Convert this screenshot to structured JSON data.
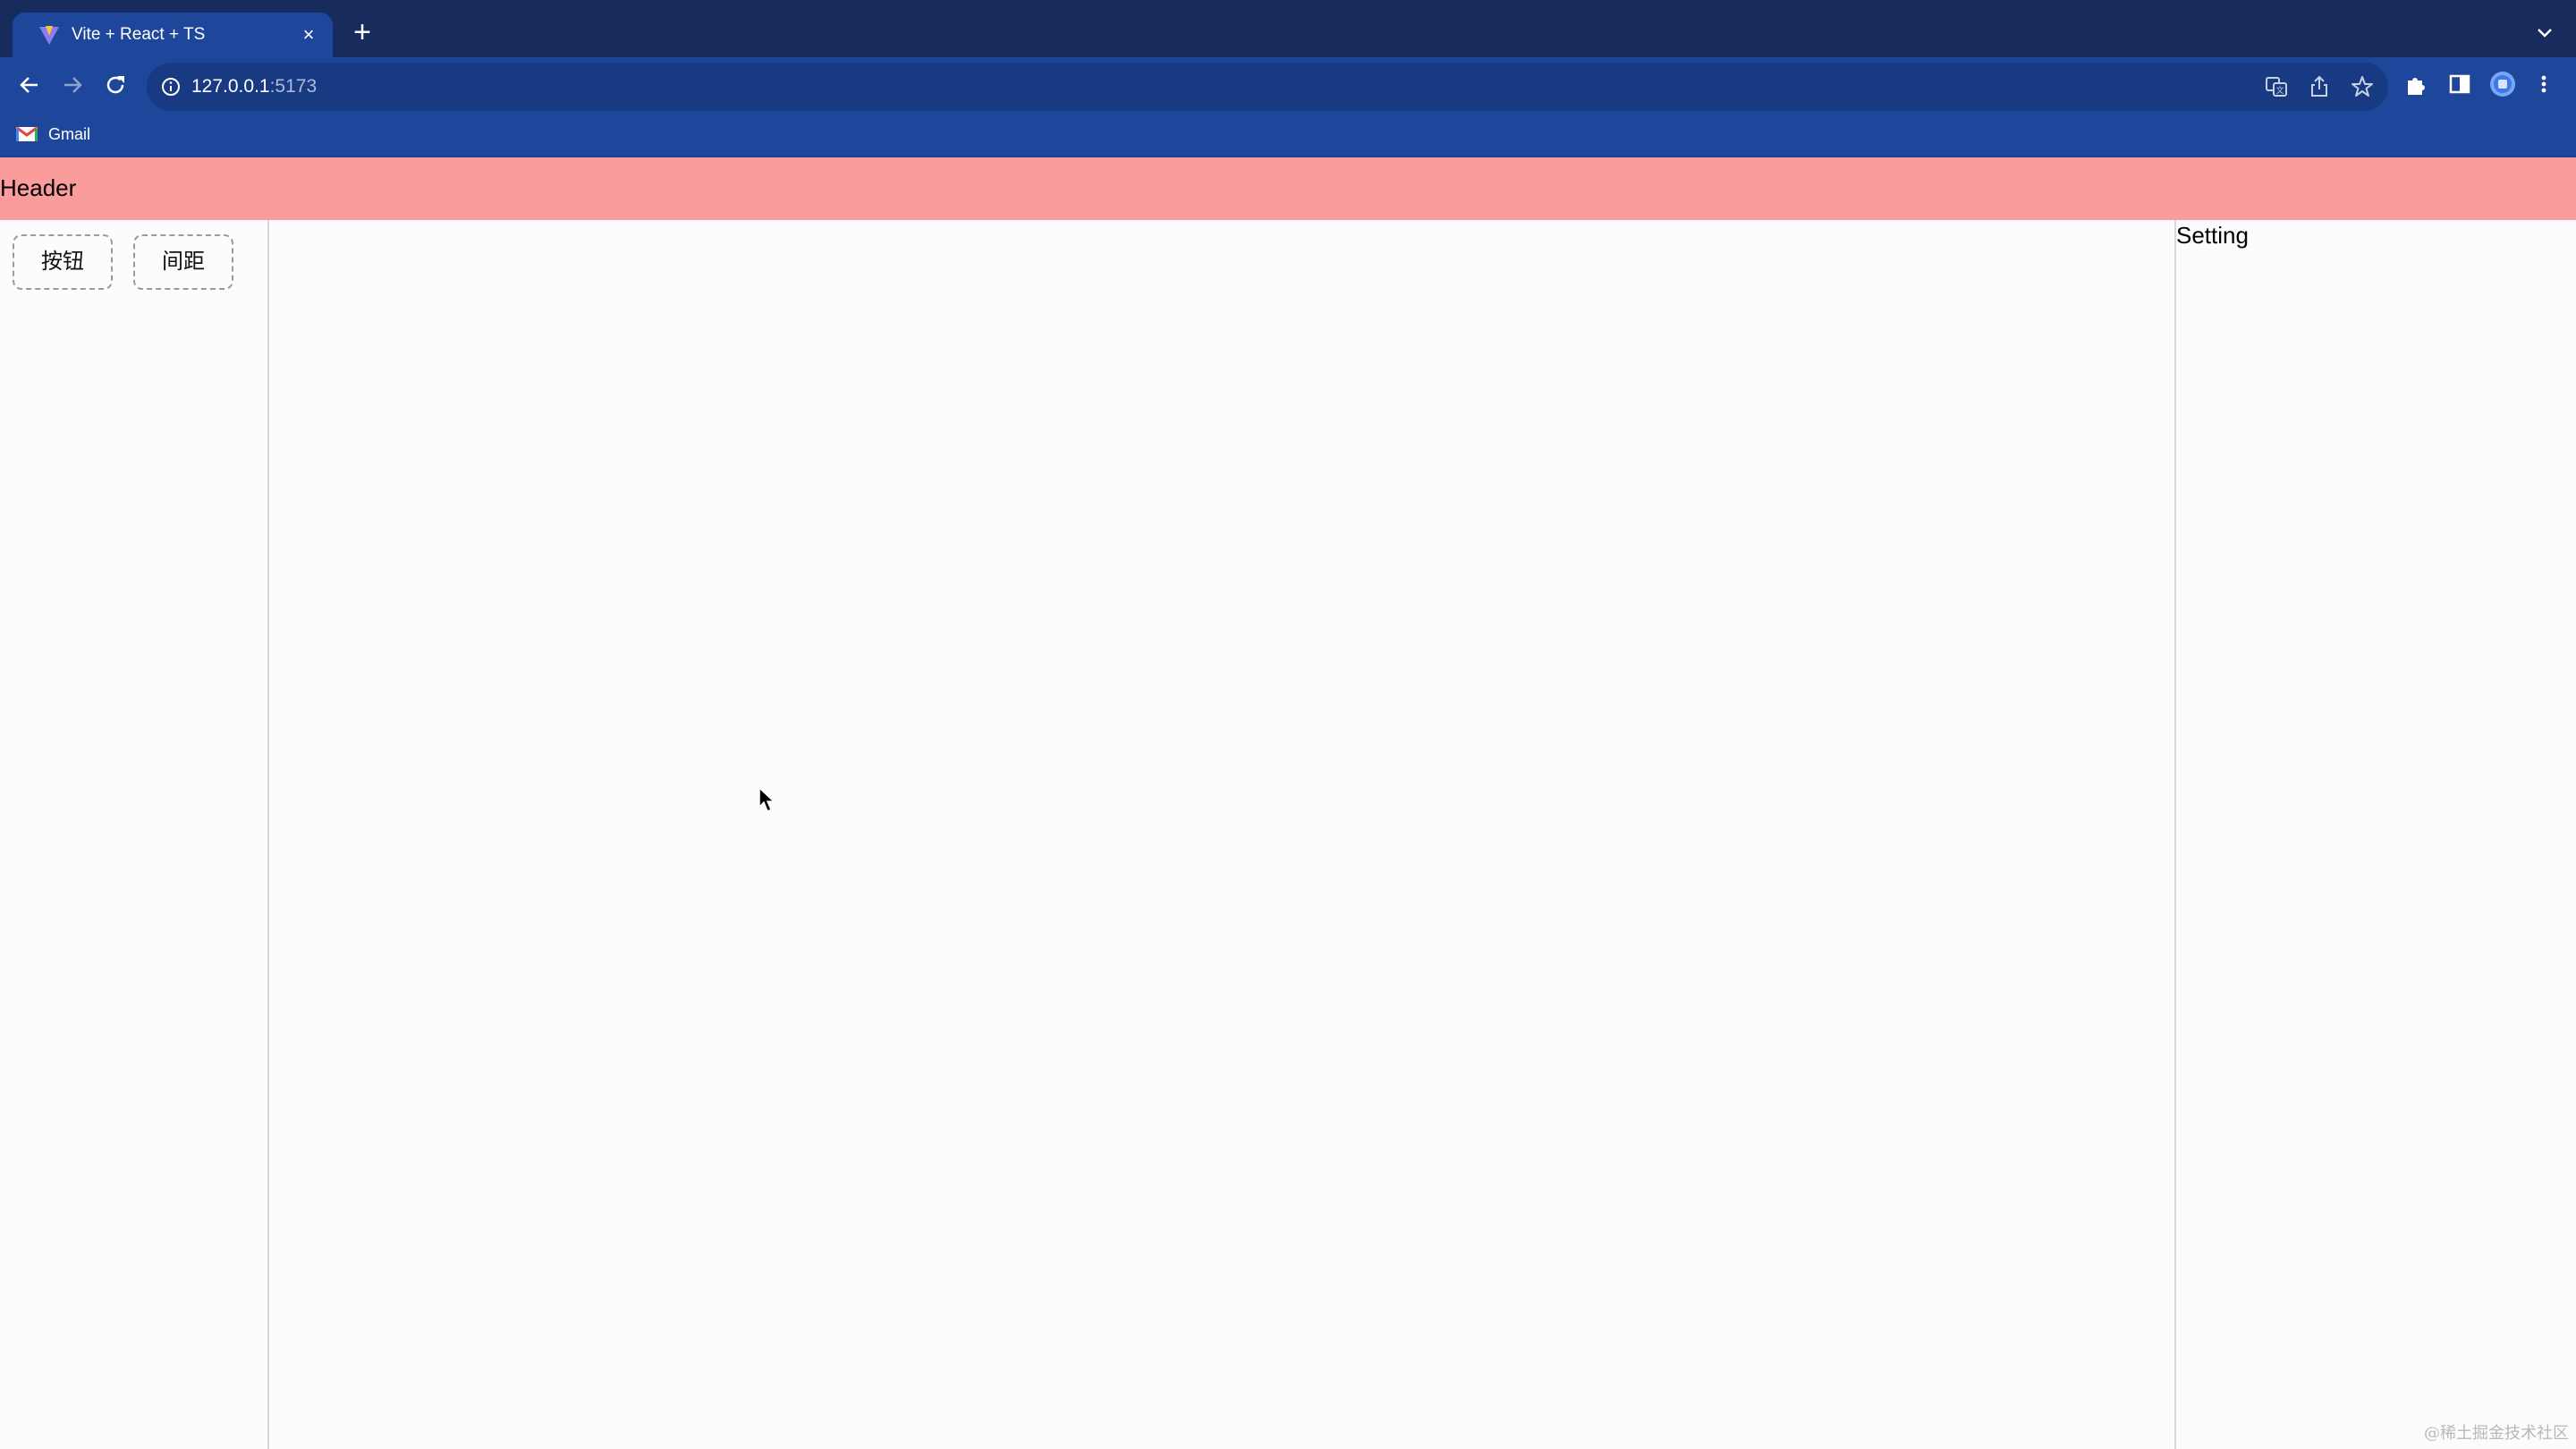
{
  "browser": {
    "tab_title": "Vite + React + TS",
    "close_glyph": "×",
    "new_tab_glyph": "+",
    "url_host": "127.0.0.1",
    "url_port": ":5173",
    "bookmarks": [
      {
        "label": "Gmail",
        "icon": "gmail-icon"
      }
    ],
    "toolbar_icons": [
      "translate-icon",
      "share-icon",
      "star-icon",
      "extensions-icon",
      "side-panel-icon",
      "profile-icon",
      "menu-icon"
    ],
    "colors": {
      "tabstrip": "#172b5c",
      "toolbar": "#1e469a",
      "omnibox": "#183a82"
    }
  },
  "app": {
    "header_title": "Header",
    "sidebar_buttons": [
      {
        "label": "按钮"
      },
      {
        "label": "间距"
      }
    ],
    "settings_title": "Setting",
    "colors": {
      "header": "#fa9b9c",
      "background": "#fdfbfd",
      "divider": "#d8d6d8"
    }
  },
  "watermark": "@稀土掘金技术社区"
}
